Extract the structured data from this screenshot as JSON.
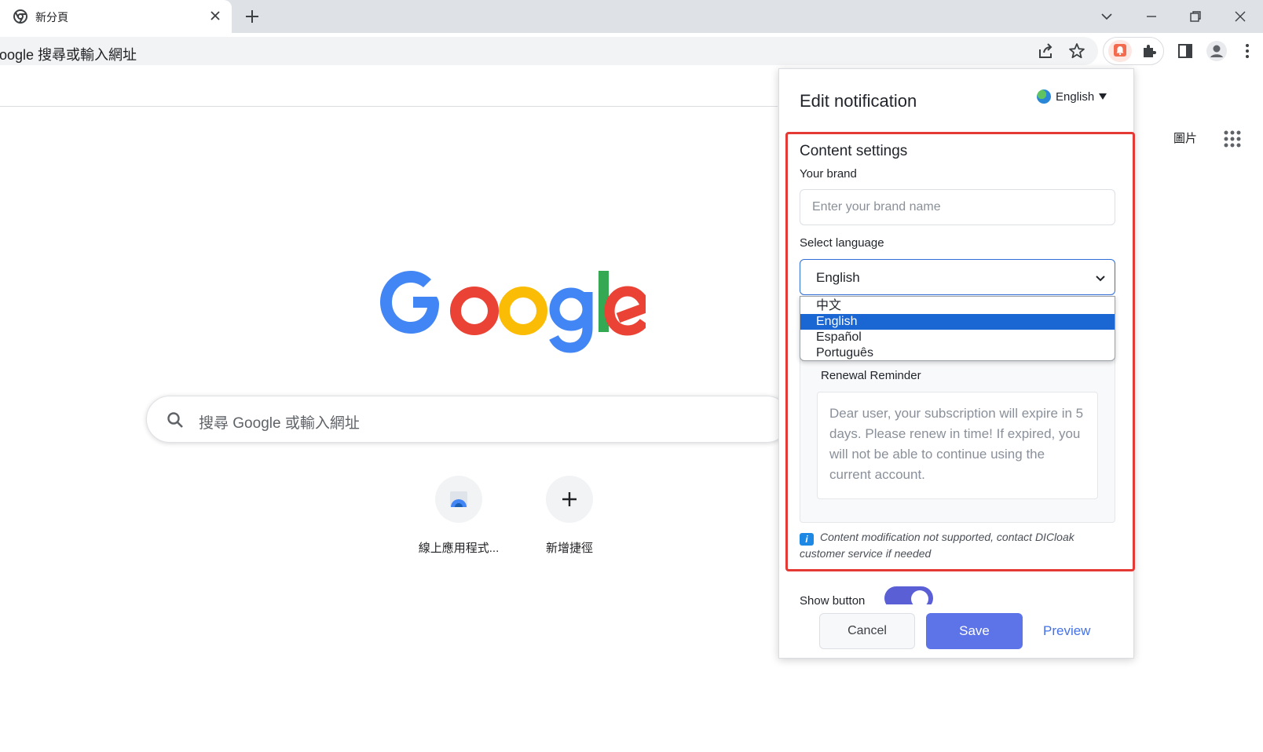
{
  "browser": {
    "tab_title": "新分頁",
    "omnibox_text": "oogle 搜尋或輸入網址"
  },
  "ntp": {
    "images_link": "圖片",
    "search_placeholder": "搜尋 Google 或輸入網址",
    "shortcuts": [
      {
        "label": "線上應用程式..."
      },
      {
        "label": "新增捷徑"
      }
    ]
  },
  "popup": {
    "title": "Edit notification",
    "ui_language": "English",
    "section_title": "Content settings",
    "brand_label": "Your brand",
    "brand_placeholder": "Enter your brand name",
    "brand_value": "",
    "language_label": "Select language",
    "language_selected": "English",
    "language_options": [
      "中文",
      "English",
      "Español",
      "Português"
    ],
    "message_title": "Renewal Reminder",
    "message_body": "Dear user, your subscription will expire in 5 days. Please renew in time! If expired, you will not be able to continue using the current account.",
    "hint_icon_label": "i",
    "hint_text": "Content modification not supported, contact DICloak customer service if needed",
    "show_button_label": "Show button",
    "show_button_enabled": true,
    "cancel_label": "Cancel",
    "save_label": "Save",
    "preview_label": "Preview"
  },
  "colors": {
    "highlight_frame": "#e53935",
    "save_button": "#5d73e8",
    "toggle_on": "#5a5fd6",
    "selected_option": "#1a66d2",
    "preview_link": "#4472e6"
  }
}
